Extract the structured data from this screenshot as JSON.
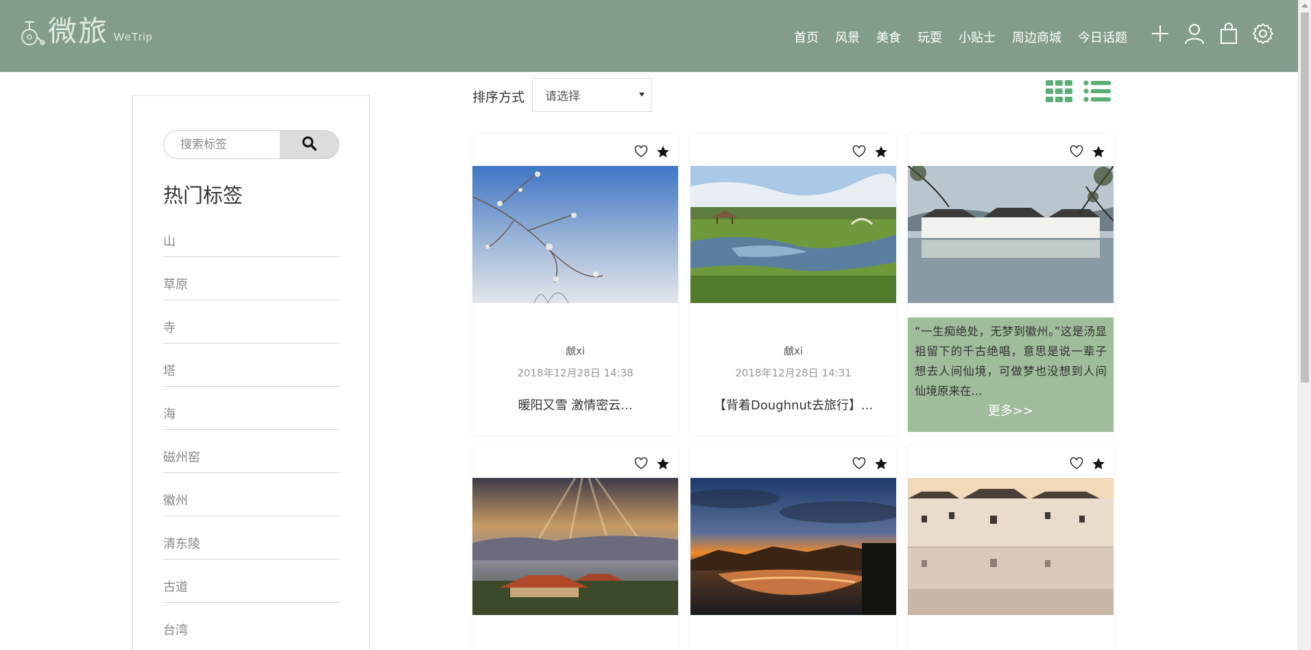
{
  "header": {
    "logo_cn": "微旅",
    "logo_en": "WeTrip",
    "nav": [
      "首页",
      "风景",
      "美食",
      "玩耍",
      "小贴士",
      "周边商城",
      "今日话题"
    ],
    "icons": [
      "plus-icon",
      "user-icon",
      "cart-icon",
      "settings-icon"
    ]
  },
  "sidebar": {
    "search_placeholder": "搜索标签",
    "tags_title": "热门标签",
    "tags": [
      "山",
      "草原",
      "寺",
      "塔",
      "海",
      "磁州窑",
      "徽州",
      "清东陵",
      "古道",
      "台湾"
    ]
  },
  "toolbar": {
    "sort_label": "排序方式",
    "sort_value": "请选择"
  },
  "cards": [
    {
      "author": "虤xi",
      "date": "2018年12月28日 14:38",
      "title": "暖阳又雪 激情密云...",
      "image": "snowy-branch-sky"
    },
    {
      "author": "虤xi",
      "date": "2018年12月28日 14:31",
      "title": "【背着Doughnut去旅行】...",
      "image": "grassland-river"
    },
    {
      "overlay_text": "“一生痴绝处，无梦到徽州。”这是汤显祖留下的千古绝唱，意思是说一辈子想去人间仙境，可做梦也没想到人间仙境原来在...",
      "more": "更多>>",
      "image": "huizhou-village-lake"
    },
    {
      "image": "temple-sunrays-valley"
    },
    {
      "image": "sunset-canyon-lake"
    },
    {
      "image": "huizhou-reflection-vintage"
    }
  ],
  "colors": {
    "header_bg": "#829e8a",
    "accent_green": "#5aae78",
    "overlay_bg": "#9fbd9a"
  }
}
